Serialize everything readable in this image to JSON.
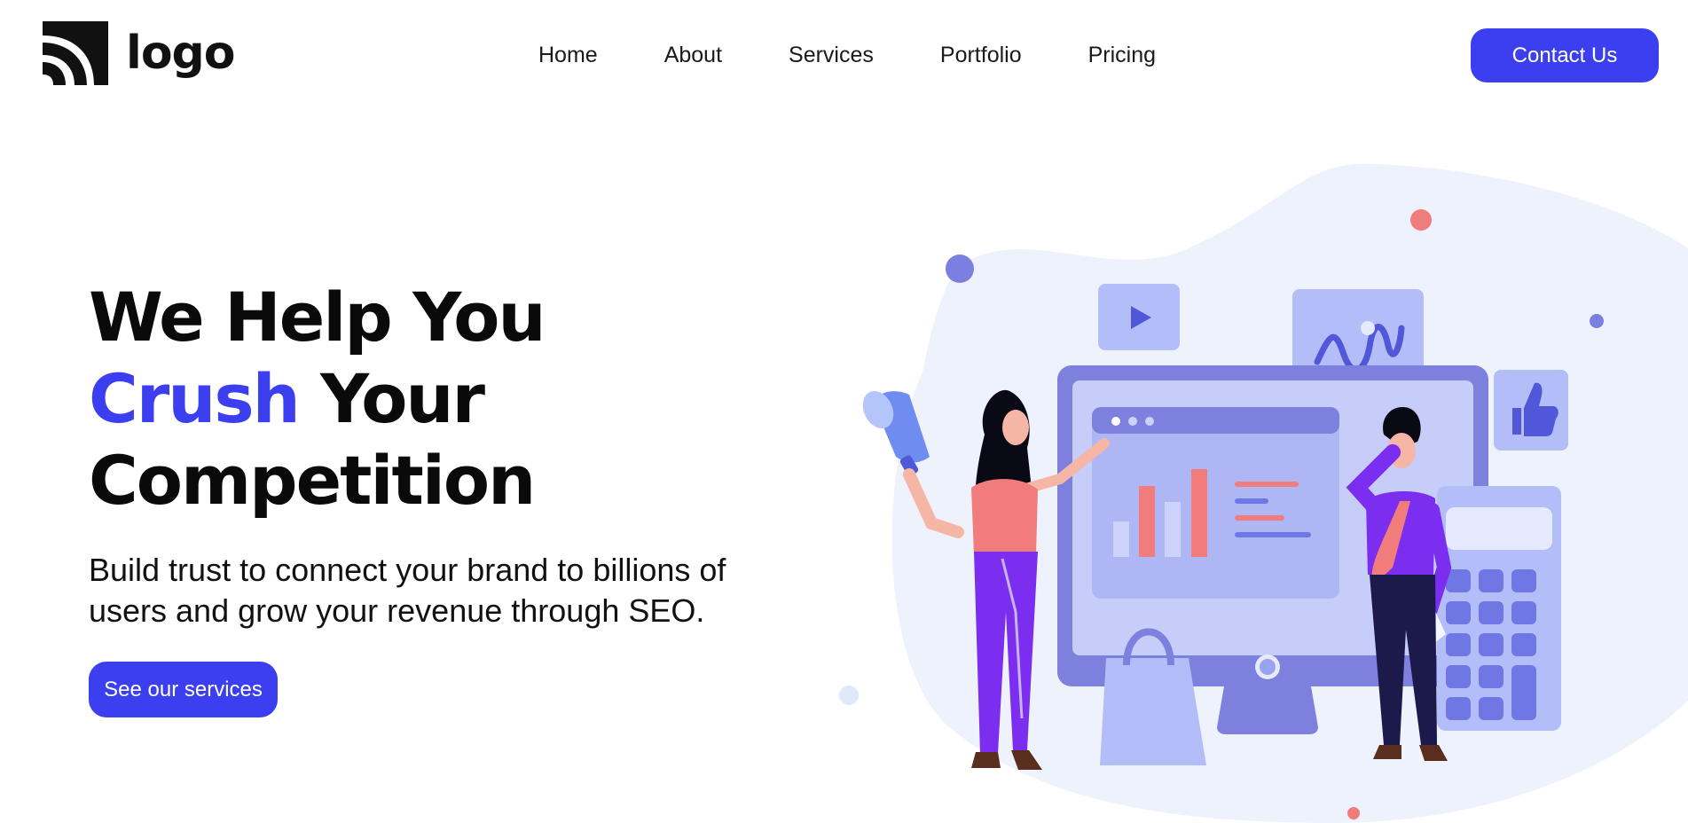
{
  "header": {
    "logo_text": "logo",
    "logo_icon": "wifi-arcs-icon",
    "nav": [
      {
        "label": "Home"
      },
      {
        "label": "About"
      },
      {
        "label": "Services"
      },
      {
        "label": "Portfolio"
      },
      {
        "label": "Pricing"
      }
    ],
    "contact_label": "Contact Us"
  },
  "hero": {
    "title_line1": "We Help You",
    "title_accent": "Crush",
    "title_line2_rest": " Your",
    "title_line3": "Competition",
    "subtitle_line1": "Build trust to connect your brand to billions of",
    "subtitle_line2": "users and grow your revenue through SEO.",
    "cta_label": "See our services"
  },
  "colors": {
    "accent": "#3b3ff0",
    "text": "#0a0a0a",
    "illustration_bg": "#eef2fd"
  }
}
